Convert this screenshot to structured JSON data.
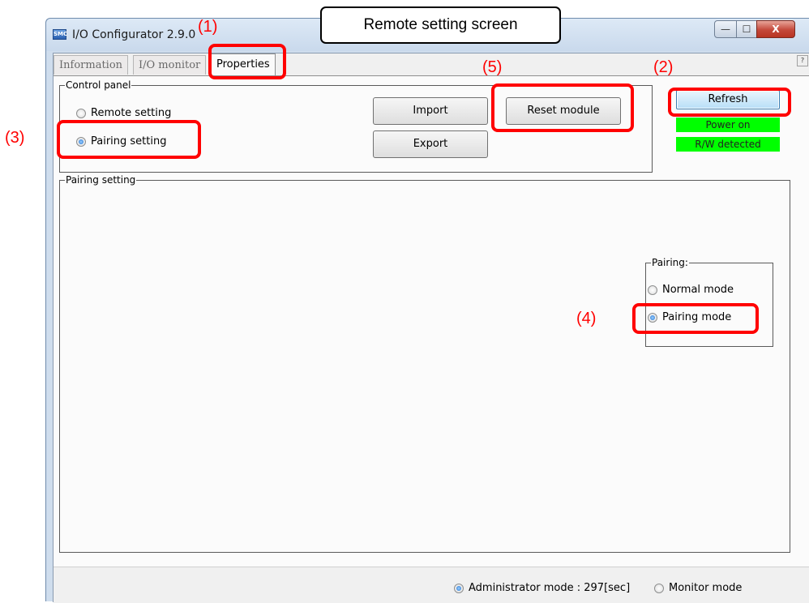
{
  "window": {
    "title": "I/O Configurator 2.9.0",
    "app_icon_text": "SMC",
    "minimize_glyph": "—",
    "maximize_glyph": "☐",
    "close_glyph": "X"
  },
  "tabs": [
    {
      "label": "Information",
      "active": false
    },
    {
      "label": "I/O monitor",
      "active": false
    },
    {
      "label": "Properties",
      "active": true
    }
  ],
  "help_glyph": "?",
  "control_panel": {
    "label": "Control panel",
    "radios": [
      {
        "label": "Remote setting",
        "selected": false
      },
      {
        "label": "Pairing setting",
        "selected": true
      }
    ],
    "buttons": {
      "import": "Import",
      "export": "Export",
      "reset": "Reset module"
    }
  },
  "refresh_label": "Refresh",
  "status": {
    "power": "Power on",
    "rw": "R/W detected",
    "color": "#00ff00"
  },
  "pairing_setting": {
    "label": "Pairing setting",
    "pairing_group": {
      "label": "Pairing:",
      "radios": [
        {
          "label": "Normal mode",
          "selected": false
        },
        {
          "label": "Pairing mode",
          "selected": true
        }
      ]
    }
  },
  "statusbar": {
    "admin_mode": "Administrator mode : 297[sec]",
    "admin_selected": true,
    "monitor_mode": "Monitor mode",
    "monitor_selected": false
  },
  "annotations": {
    "screen_label": "Remote setting screen",
    "callouts": [
      "(1)",
      "(2)",
      "(3)",
      "(4)",
      "(5)"
    ],
    "color": "#ff0000"
  }
}
